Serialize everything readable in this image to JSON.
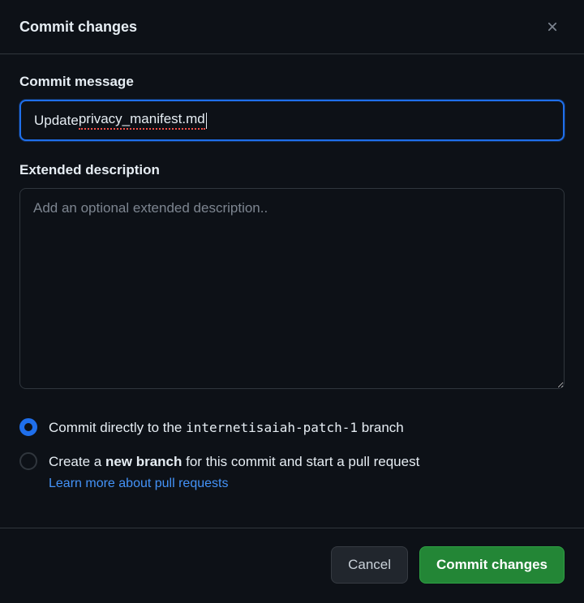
{
  "dialog": {
    "title": "Commit changes"
  },
  "commit_message": {
    "label": "Commit message",
    "value_prefix": "Update ",
    "value_spellcheck": "privacy_manifest.md"
  },
  "extended_description": {
    "label": "Extended description",
    "placeholder": "Add an optional extended description..",
    "value": ""
  },
  "branch_options": {
    "direct": {
      "prefix": "Commit directly to the ",
      "branch": "internetisaiah-patch-1",
      "suffix": " branch"
    },
    "new_branch": {
      "text_a": "Create a ",
      "bold": "new branch",
      "text_b": " for this commit and start a pull request"
    },
    "learn_more": "Learn more about pull requests"
  },
  "footer": {
    "cancel": "Cancel",
    "commit": "Commit changes"
  }
}
